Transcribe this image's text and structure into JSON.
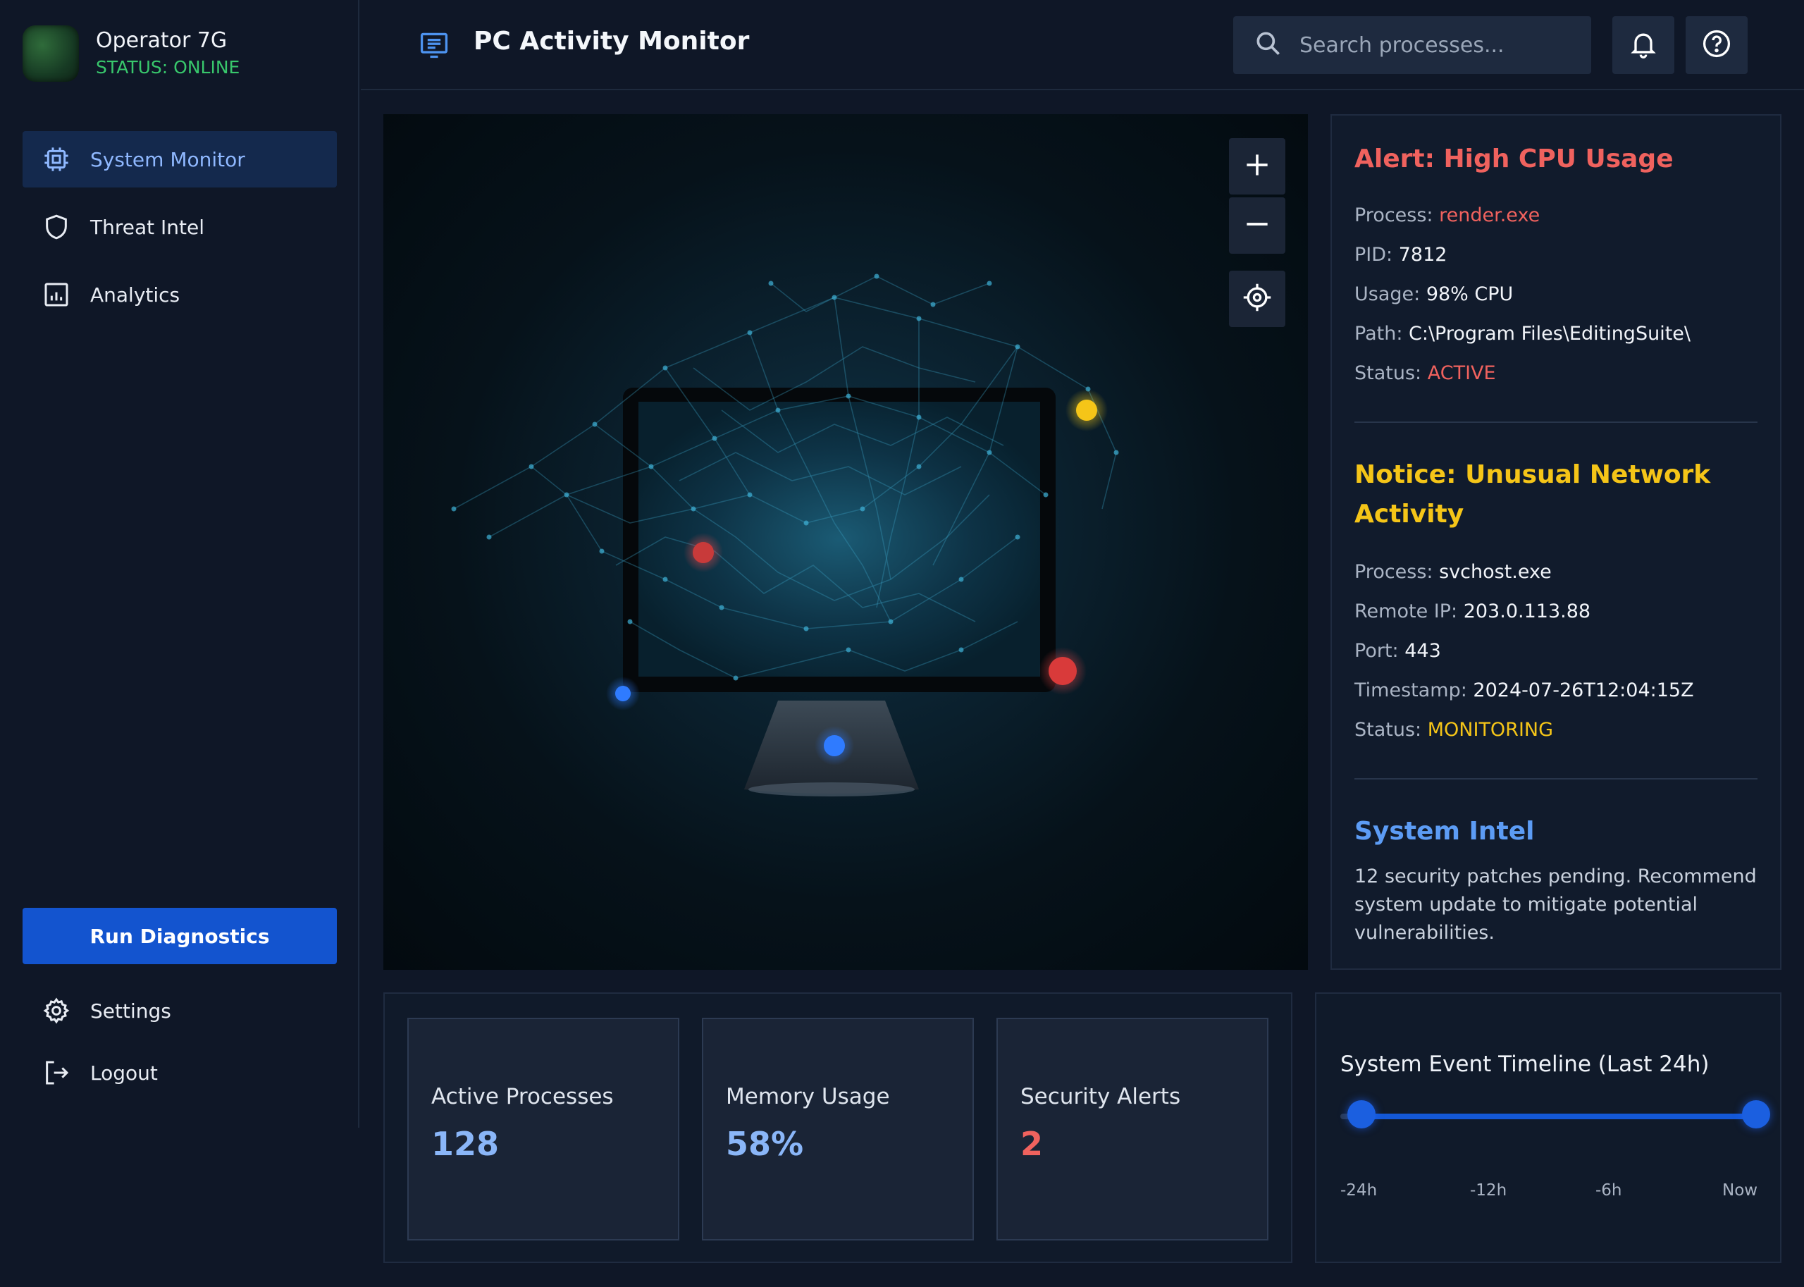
{
  "profile": {
    "name": "Operator 7G",
    "status": "STATUS: ONLINE"
  },
  "sidebar": {
    "items": [
      {
        "label": "System Monitor",
        "icon": "cpu-icon",
        "active": true
      },
      {
        "label": "Threat Intel",
        "icon": "shield-icon",
        "active": false
      },
      {
        "label": "Analytics",
        "icon": "bar-chart-icon",
        "active": false
      }
    ],
    "run_button": "Run Diagnostics",
    "bottom": [
      {
        "label": "Settings",
        "icon": "gear-icon"
      },
      {
        "label": "Logout",
        "icon": "logout-icon"
      }
    ]
  },
  "header": {
    "title": "PC Activity Monitor",
    "search_placeholder": "Search processes..."
  },
  "alerts": [
    {
      "title": "Alert: High CPU Usage",
      "color": "#f0625e",
      "fields": [
        {
          "key": "Process:",
          "value": "render.exe",
          "color": "#f0625e"
        },
        {
          "key": "PID:",
          "value": "7812"
        },
        {
          "key": "Usage:",
          "value": "98% CPU"
        },
        {
          "key": "Path:",
          "value": "C:\\Program Files\\EditingSuite\\"
        },
        {
          "key": "Status:",
          "value": "ACTIVE",
          "color": "#f0625e"
        }
      ]
    },
    {
      "title": "Notice: Unusual Network Activity",
      "title_line1": "Notice: Unusual Network",
      "title_line2": "Activity",
      "color": "#f5c518",
      "fields": [
        {
          "key": "Process:",
          "value": "svchost.exe"
        },
        {
          "key": "Remote IP:",
          "value": "203.0.113.88"
        },
        {
          "key": "Port:",
          "value": "443"
        },
        {
          "key": "Timestamp:",
          "value": "2024-07-26T12:04:15Z"
        },
        {
          "key": "Status:",
          "value": "MONITORING",
          "color": "#f5c518"
        }
      ]
    }
  ],
  "intel": {
    "title": "System Intel",
    "color": "#5c9cf5",
    "text": "12 security patches pending. Recommend system update to mitigate potential vulnerabilities."
  },
  "stats": [
    {
      "label": "Active Processes",
      "value": "128",
      "color": "#8ab6f8"
    },
    {
      "label": "Memory Usage",
      "value": "58%",
      "color": "#8ab6f8"
    },
    {
      "label": "Security Alerts",
      "value": "2",
      "color": "#f0625e"
    }
  ],
  "timeline": {
    "title": "System Event Timeline (Last 24h)",
    "ticks": [
      "-24h",
      "-12h",
      "-6h",
      "Now"
    ],
    "range_start_fraction": 0.05,
    "range_end_fraction": 1.0
  },
  "colors": {
    "accent": "#1354cf",
    "background": "#0f1727",
    "online": "#38c76c",
    "danger": "#f0625e",
    "warning": "#f5c518"
  }
}
